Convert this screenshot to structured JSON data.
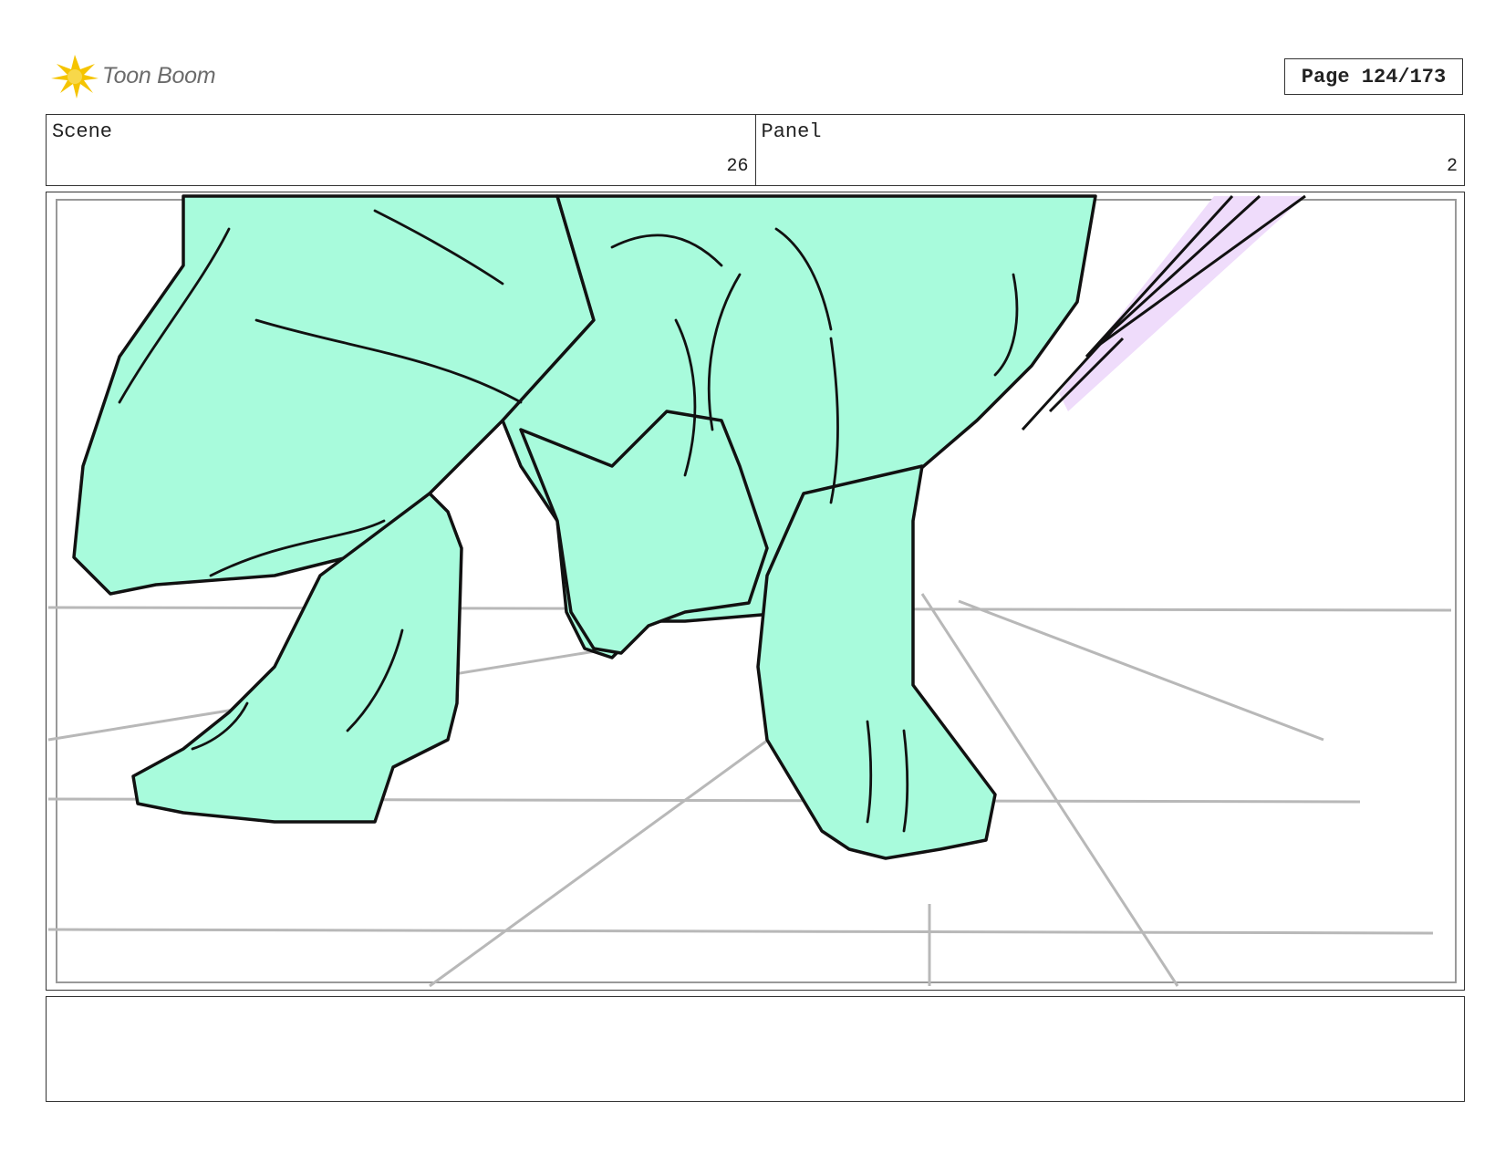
{
  "header": {
    "logo_text": "Toon Boom",
    "page_label": "Page 124/173"
  },
  "scene": {
    "label": "Scene",
    "value": "26"
  },
  "panel": {
    "label": "Panel",
    "value": "2"
  },
  "artwork": {
    "description_icon": "storyboard-sketch",
    "fill_color": "#a8fbdc",
    "accent_color": "#efdcfb",
    "line_color": "#111111",
    "guide_color": "#b8b8b8"
  },
  "notes": {
    "text": ""
  }
}
